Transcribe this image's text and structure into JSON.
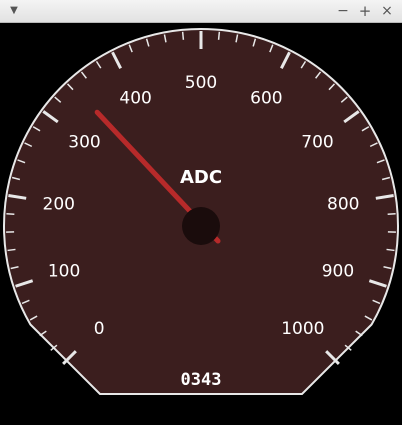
{
  "window": {
    "menu_icon": "chevron-down-icon",
    "minimize_label": "−",
    "maximize_label": "+",
    "close_label": "×"
  },
  "gauge": {
    "title": "ADC",
    "readout": "0343",
    "value": 343,
    "min": 0,
    "max": 1000,
    "major_labels": [
      "0",
      "100",
      "200",
      "300",
      "400",
      "500",
      "600",
      "700",
      "800",
      "900",
      "1000"
    ],
    "minor_per_major": 5,
    "colors": {
      "face": "#3b1e1e",
      "rim": "#e8e8e8",
      "needle": "#b72a2a",
      "hub": "#1a0c0c",
      "text": "#ffffff"
    }
  }
}
